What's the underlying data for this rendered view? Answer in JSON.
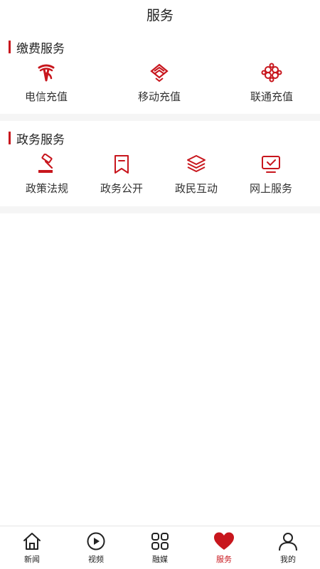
{
  "header": {
    "title": "服务"
  },
  "payment": {
    "title": "缴费服务",
    "items": [
      {
        "label": "电信充值",
        "icon": "china-telecom-icon"
      },
      {
        "label": "移动充值",
        "icon": "china-mobile-icon"
      },
      {
        "label": "联通充值",
        "icon": "china-unicom-icon"
      }
    ]
  },
  "government": {
    "title": "政务服务",
    "items": [
      {
        "label": "政策法规",
        "icon": "gavel-icon"
      },
      {
        "label": "政务公开",
        "icon": "bookmark-icon"
      },
      {
        "label": "政民互动",
        "icon": "layers-icon"
      },
      {
        "label": "网上服务",
        "icon": "monitor-check-icon"
      }
    ]
  },
  "tabbar": {
    "active": "服务",
    "items": [
      {
        "label": "新闻",
        "icon": "home-icon"
      },
      {
        "label": "视频",
        "icon": "play-circle-icon"
      },
      {
        "label": "融媒",
        "icon": "grid-icon"
      },
      {
        "label": "服务",
        "icon": "heart-icon"
      },
      {
        "label": "我的",
        "icon": "user-icon"
      }
    ]
  },
  "colors": {
    "accent": "#c8161d",
    "divider": "#f5f5f5",
    "text": "#333333"
  }
}
